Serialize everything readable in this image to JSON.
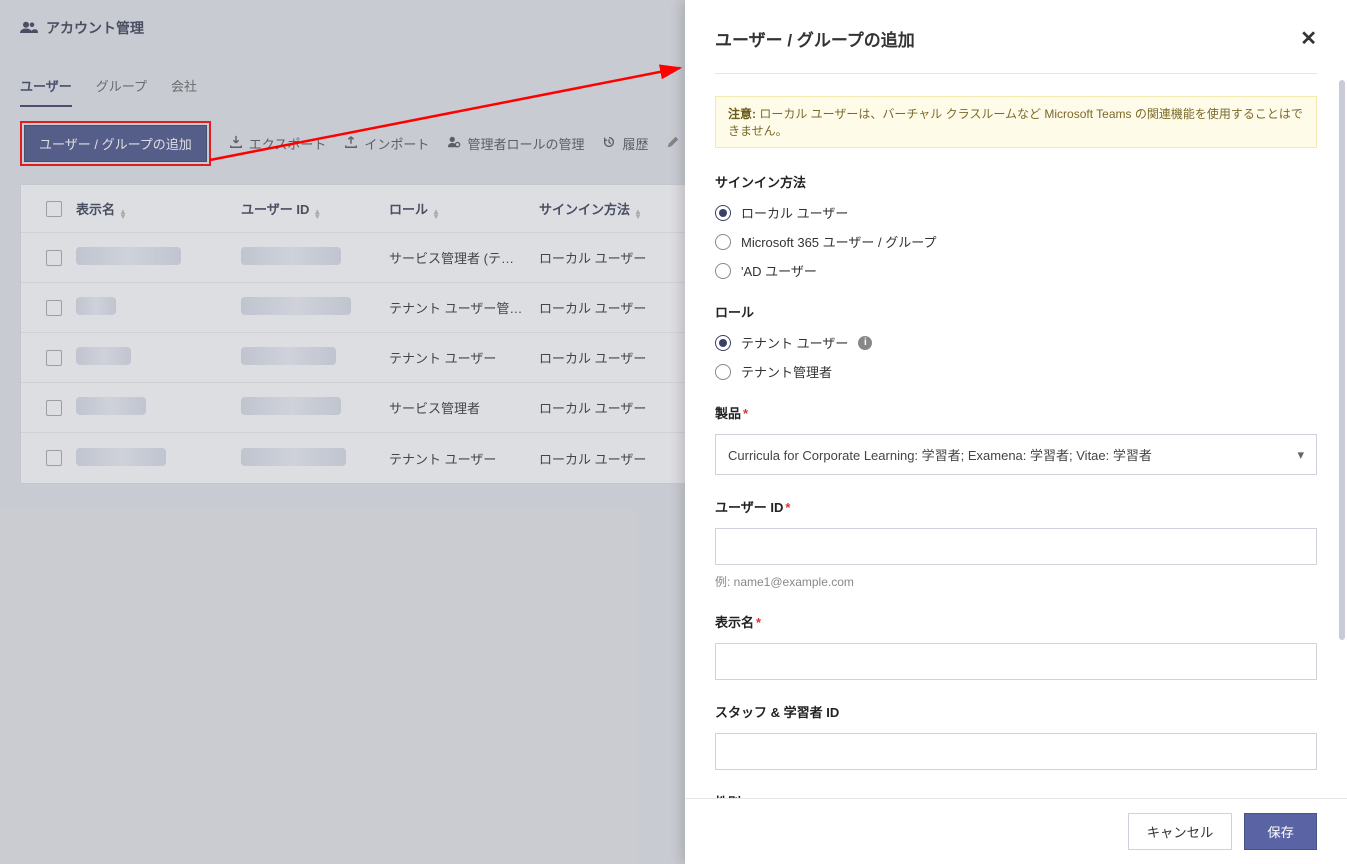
{
  "header": {
    "title": "アカウント管理"
  },
  "tabs": [
    {
      "label": "ユーザー",
      "active": true
    },
    {
      "label": "グループ",
      "active": false
    },
    {
      "label": "会社",
      "active": false
    }
  ],
  "toolbar": {
    "add_button": "ユーザー / グループの追加",
    "export": "エクスポート",
    "import": "インポート",
    "manage_roles": "管理者ロールの管理",
    "history": "履歴"
  },
  "table": {
    "columns": {
      "display_name": "表示名",
      "user_id": "ユーザー ID",
      "role": "ロール",
      "signin": "サインイン方法"
    },
    "rows": [
      {
        "role": "サービス管理者 (テ…",
        "signin": "ローカル ユーザー"
      },
      {
        "role": "テナント ユーザー管…",
        "signin": "ローカル ユーザー"
      },
      {
        "role": "テナント ユーザー",
        "signin": "ローカル ユーザー"
      },
      {
        "role": "サービス管理者",
        "signin": "ローカル ユーザー"
      },
      {
        "role": "テナント ユーザー",
        "signin": "ローカル ユーザー"
      }
    ]
  },
  "panel": {
    "title": "ユーザー / グループの追加",
    "alert_prefix": "注意:",
    "alert_text": " ローカル ユーザーは、バーチャル クラスルームなど Microsoft Teams の関連機能を使用することはできません。",
    "signin_label": "サインイン方法",
    "signin_options": {
      "local": "ローカル ユーザー",
      "m365": "Microsoft 365 ユーザー / グループ",
      "ad": "'AD ユーザー"
    },
    "role_label": "ロール",
    "role_options": {
      "tenant_user": "テナント ユーザー",
      "tenant_admin": "テナント管理者"
    },
    "product_label": "製品",
    "product_value": "Curricula for Corporate Learning: 学習者; Examena: 学習者; Vitae: 学習者",
    "userid_label": "ユーザー ID",
    "userid_hint": "例: name1@example.com",
    "display_name_label": "表示名",
    "staff_id_label": "スタッフ & 学習者 ID",
    "gender_label": "性別",
    "cancel": "キャンセル",
    "save": "保存"
  }
}
